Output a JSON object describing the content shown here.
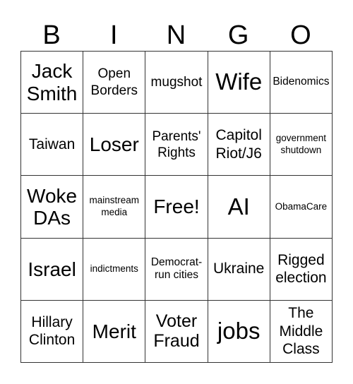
{
  "card": {
    "header": [
      "B",
      "I",
      "N",
      "G",
      "O"
    ],
    "cells": [
      [
        {
          "text": "Jack\nSmith",
          "size": "l"
        },
        {
          "text": "Open\nBorders",
          "size": "s"
        },
        {
          "text": "mugshot",
          "size": "s"
        },
        {
          "text": "Wife",
          "size": "xl"
        },
        {
          "text": "Bidenomics",
          "size": "xs"
        }
      ],
      [
        {
          "text": "Taiwan",
          "size": "ms"
        },
        {
          "text": "Loser",
          "size": "l"
        },
        {
          "text": "Parents'\nRights",
          "size": "s"
        },
        {
          "text": "Capitol\nRiot/J6",
          "size": "ms"
        },
        {
          "text": "government\nshutdown",
          "size": "xxs"
        }
      ],
      [
        {
          "text": "Woke\nDAs",
          "size": "l"
        },
        {
          "text": "mainstream\nmedia",
          "size": "xxs"
        },
        {
          "text": "Free!",
          "size": "l",
          "free": true
        },
        {
          "text": "AI",
          "size": "xl"
        },
        {
          "text": "ObamaCare",
          "size": "xxs"
        }
      ],
      [
        {
          "text": "Israel",
          "size": "l"
        },
        {
          "text": "indictments",
          "size": "xxs"
        },
        {
          "text": "Democrat-\nrun cities",
          "size": "xs"
        },
        {
          "text": "Ukraine",
          "size": "ms"
        },
        {
          "text": "Rigged\nelection",
          "size": "ms"
        }
      ],
      [
        {
          "text": "Hillary\nClinton",
          "size": "ms"
        },
        {
          "text": "Merit",
          "size": "l"
        },
        {
          "text": "Voter\nFraud",
          "size": "m"
        },
        {
          "text": "jobs",
          "size": "xl"
        },
        {
          "text": "The\nMiddle\nClass",
          "size": "ms"
        }
      ]
    ]
  }
}
